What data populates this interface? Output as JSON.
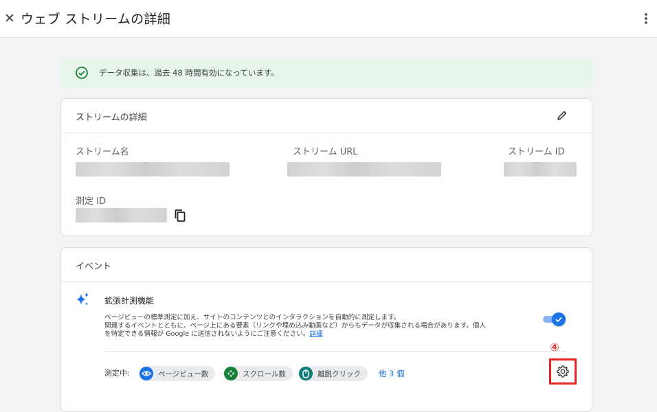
{
  "header": {
    "title": "ウェブ ストリームの詳細"
  },
  "banner": {
    "text": "データ収集は、過去 48 時間有効になっています。"
  },
  "stream_details": {
    "title": "ストリームの詳細",
    "name_label": "ストリーム名",
    "url_label": "ストリーム URL",
    "id_label": "ストリーム ID",
    "measurement_id_label": "測定 ID"
  },
  "events": {
    "title": "イベント",
    "enhanced": {
      "title": "拡張計測機能",
      "desc_line1": "ページビューの標準測定に加え、サイトのコンテンツとのインタラクションを自動的に測定します。",
      "desc_line2": "関連するイベントとともに、ページ上にある要素（リンクや埋め込み動画など）からもデータが収集される場合があります。個人",
      "desc_line3": "を特定できる情報が Google に送信されないようにご注意ください。",
      "learn_more": "詳細",
      "toggle_on": true,
      "measuring_label": "測定中:",
      "chips": [
        {
          "label": "ページビュー数",
          "icon": "eye-icon",
          "color": "#1a73e8"
        },
        {
          "label": "スクロール数",
          "icon": "scroll-icon",
          "color": "#188038"
        },
        {
          "label": "離脱クリック",
          "icon": "mouse-icon",
          "color": "#12797d"
        }
      ],
      "more": "他 3 個"
    }
  },
  "annotation": {
    "number": "④",
    "color": "#e8211c"
  },
  "colors": {
    "accent": "#1a73e8",
    "success": "#188038",
    "banner_bg": "#e6f4ea"
  }
}
